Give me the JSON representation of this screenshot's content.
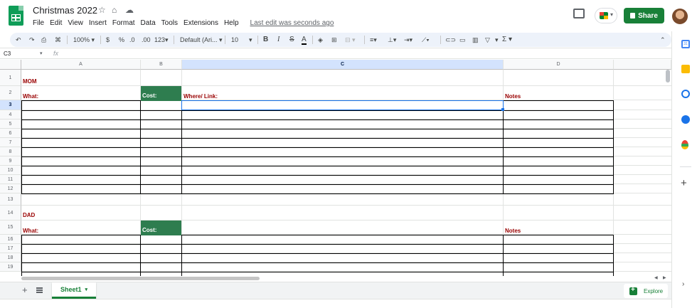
{
  "document": {
    "title": "Christmas 2022",
    "last_edit": "Last edit was seconds ago"
  },
  "menu": [
    "File",
    "Edit",
    "View",
    "Insert",
    "Format",
    "Data",
    "Tools",
    "Extensions",
    "Help"
  ],
  "header": {
    "share_label": "Share"
  },
  "toolbar": {
    "zoom": "100%",
    "currency": "$",
    "percent": "%",
    "decrease_decimal": ".0",
    "increase_decimal": ".00",
    "more_formats": "123",
    "font": "Default (Ari...",
    "font_size": "10",
    "bold": "B",
    "italic": "I",
    "strikethrough": "S",
    "text_color": "A",
    "functions": "Σ"
  },
  "formula_bar": {
    "name_box": "C3",
    "fx": "fx",
    "value": ""
  },
  "grid": {
    "columns": [
      "A",
      "B",
      "C",
      "D"
    ],
    "rows": [
      "1",
      "2",
      "3",
      "4",
      "5",
      "6",
      "7",
      "8",
      "9",
      "10",
      "11",
      "12",
      "13",
      "14",
      "15",
      "16",
      "17",
      "18",
      "19"
    ],
    "selected_cell": "C3"
  },
  "cells": {
    "mom_title": "MOM",
    "mom_what": "What:",
    "mom_cost": "Cost:",
    "mom_where": "Where/ Link:",
    "mom_notes": "Notes",
    "dad_title": "DAD",
    "dad_what": "What:",
    "dad_cost": "Cost:",
    "dad_notes": "Notes"
  },
  "sheets": {
    "active": "Sheet1",
    "explore_label": "Explore"
  },
  "colors": {
    "share_green": "#188038",
    "label_red": "#990000",
    "cost_fill": "#2e7d4f",
    "selection_blue": "#1a73e8"
  }
}
